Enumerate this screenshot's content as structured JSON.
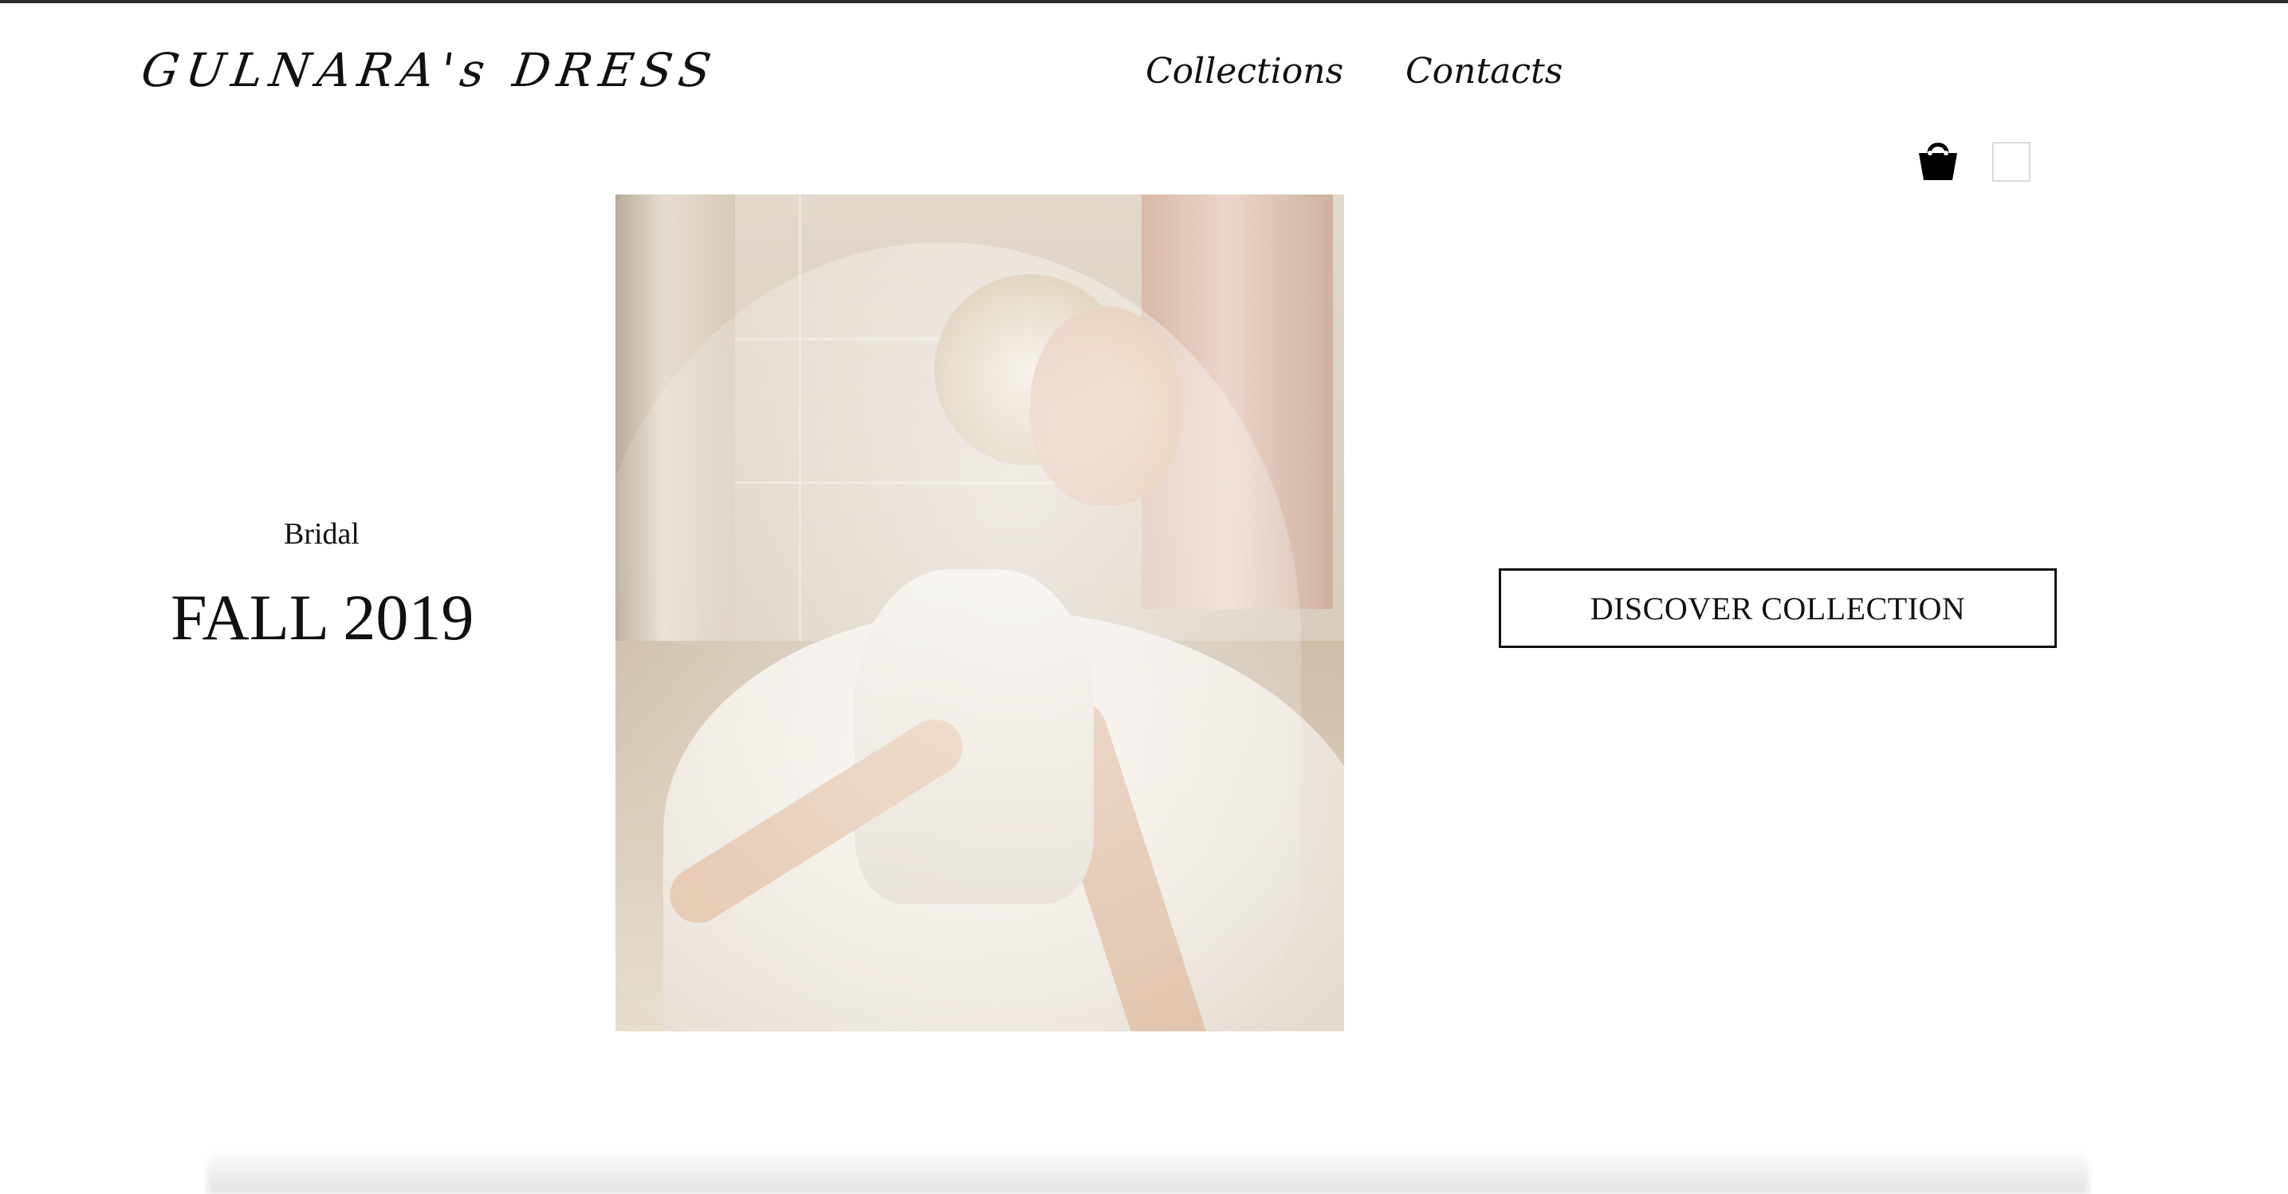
{
  "header": {
    "logo": "GULNARA's DRESS",
    "nav": [
      {
        "label": "Collections"
      },
      {
        "label": "Contacts"
      }
    ],
    "icons": {
      "cart": "shopping-bag-icon",
      "user": "user-login-box"
    }
  },
  "hero": {
    "subtitle": "Bridal",
    "title": "FALL 2019",
    "button_label": "DISCOVER COLLECTION",
    "image": "bride-in-veil-photo"
  }
}
